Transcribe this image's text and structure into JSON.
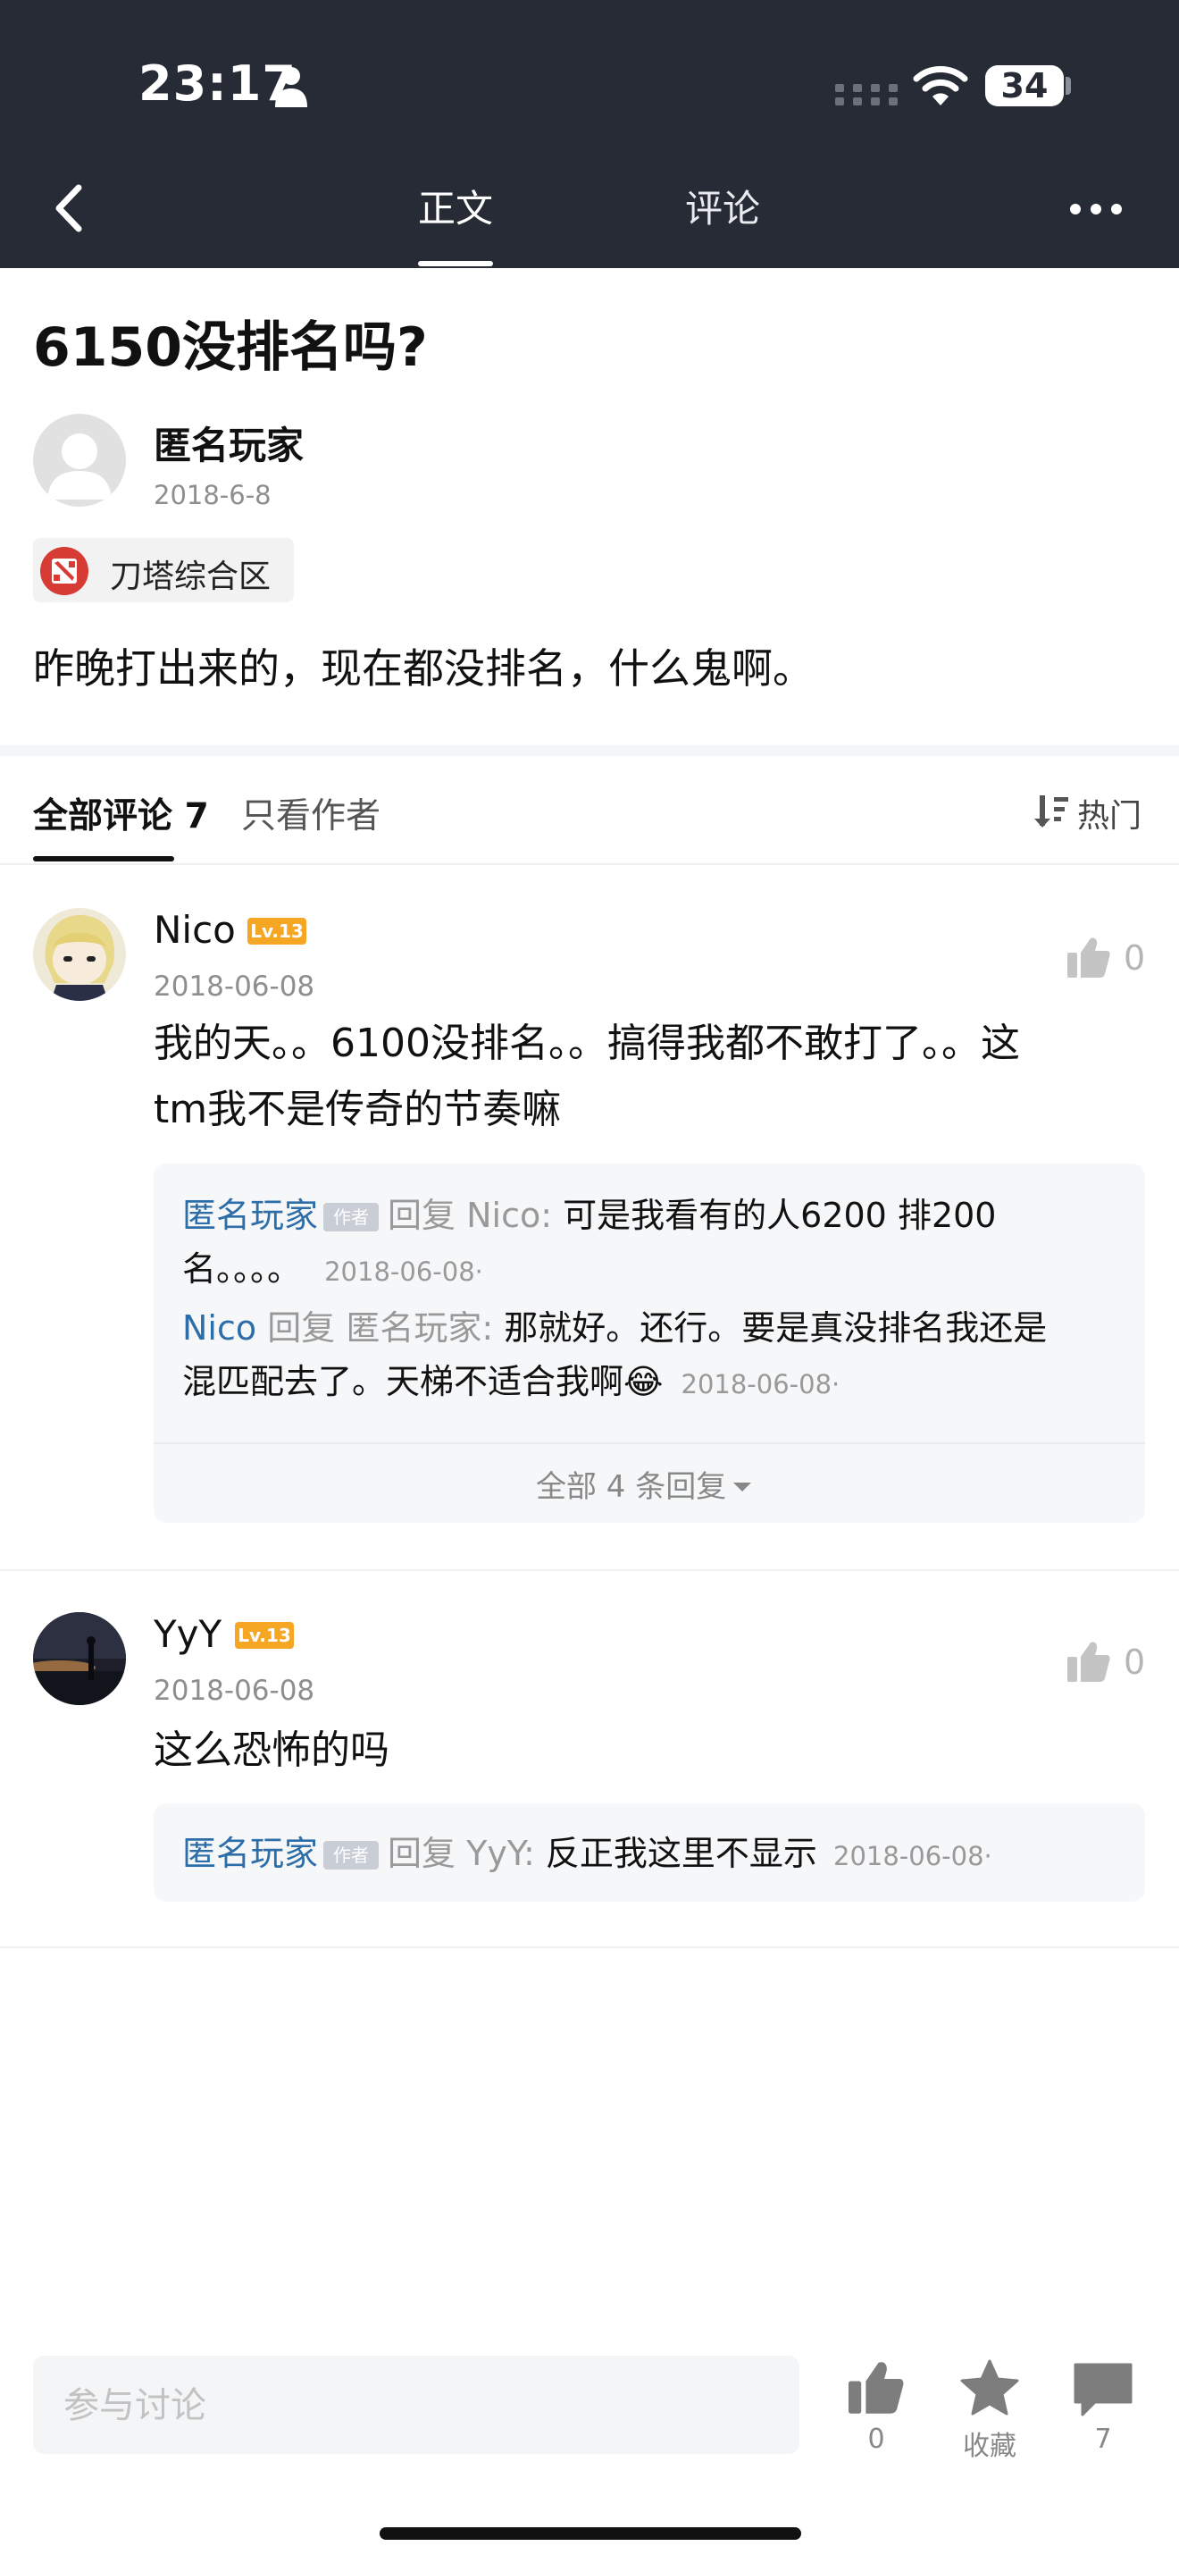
{
  "status_bar": {
    "time": "23:17",
    "battery": "34"
  },
  "nav": {
    "tab_body": "正文",
    "tab_comments": "评论"
  },
  "post": {
    "title": "6150没排名吗?",
    "author": "匿名玩家",
    "date": "2018-6-8",
    "forum": "刀塔综合区",
    "body": "昨晚打出来的，现在都没排名，什么鬼啊。"
  },
  "comment_tabs": {
    "all": "全部评论 7",
    "author_only": "只看作者",
    "sort": "热门"
  },
  "comments": [
    {
      "user": "Nico",
      "level": "Lv.13",
      "date": "2018-06-08",
      "likes": "0",
      "text_line1": "我的天。。6100没排名。。搞得我都不敢打了。。这",
      "text_line2": "tm我不是传奇的节奏嘛",
      "replies": [
        {
          "from": "匿名玩家",
          "badge": "作者",
          "verb": "回复",
          "to": "Nico:",
          "text_line1": "可是我看有的人6200 排200",
          "text_line2": "名。。。。",
          "date": "2018-06-08·"
        },
        {
          "from": "Nico",
          "verb": "回复",
          "to": "匿名玩家:",
          "text_line1": "那就好。还行。要是真没排名我还是",
          "text_line2": "混匹配去了。天梯不适合我啊😂",
          "date": "2018-06-08·"
        }
      ],
      "more_replies": "全部 4 条回复"
    },
    {
      "user": "YyY",
      "level": "Lv.13",
      "date": "2018-06-08",
      "likes": "0",
      "text_line1": "这么恐怖的吗",
      "replies": [
        {
          "from": "匿名玩家",
          "badge": "作者",
          "verb": "回复",
          "to": "YyY:",
          "text_line1": "反正我这里不显示",
          "date": "2018-06-08·"
        }
      ]
    }
  ],
  "bottom_bar": {
    "input_placeholder": "参与讨论",
    "like_count": "0",
    "favorite_label": "收藏",
    "comment_count": "7"
  },
  "icons": [
    "person-icon",
    "signal-dots-icon",
    "wifi-icon",
    "battery-icon",
    "back-icon",
    "more-icon",
    "forum-icon",
    "sort-icon",
    "thumb-up-icon",
    "star-icon",
    "comment-icon"
  ],
  "colors": {
    "nav_background": "#262b36",
    "reply_user": "#2e6ea8",
    "level_badge": "#f5a623",
    "forum_icon": "#d63b34"
  }
}
